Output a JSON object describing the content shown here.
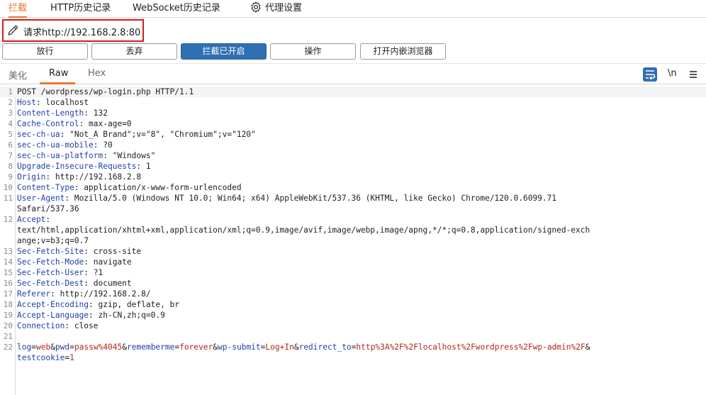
{
  "top_tabs": [
    "拦截",
    "HTTP历史记录",
    "WebSocket历史记录",
    "代理设置"
  ],
  "request_line": "请求http://192.168.2.8:80",
  "buttons": {
    "forward": "放行",
    "drop": "丢弃",
    "intercept": "拦截已开启",
    "action": "操作",
    "browser": "打开内嵌浏览器"
  },
  "editor_tabs": [
    "美化",
    "Raw",
    "Hex"
  ],
  "tools": {
    "newline": "\\n"
  },
  "colors": {
    "accent": "#e8772e",
    "primary": "#2f6fb3",
    "highlight_box": "#d91a1a",
    "header_key": "#1f3fa8",
    "param_value": "#b0281c"
  },
  "lines": [
    {
      "n": "1",
      "key": "",
      "val": "POST /wordpress/wp-login.php HTTP/1.1"
    },
    {
      "n": "2",
      "key": "Host",
      "val": ": localhost"
    },
    {
      "n": "3",
      "key": "Content-Length",
      "val": ": 132"
    },
    {
      "n": "4",
      "key": "Cache-Control",
      "val": ": max-age=0"
    },
    {
      "n": "5",
      "key": "sec-ch-ua",
      "val": ": \"Not_A Brand\";v=\"8\", \"Chromium\";v=\"120\""
    },
    {
      "n": "6",
      "key": "sec-ch-ua-mobile",
      "val": ": ?0"
    },
    {
      "n": "7",
      "key": "sec-ch-ua-platform",
      "val": ": \"Windows\""
    },
    {
      "n": "8",
      "key": "Upgrade-Insecure-Requests",
      "val": ": 1"
    },
    {
      "n": "9",
      "key": "Origin",
      "val": ": http://192.168.2.8"
    },
    {
      "n": "10",
      "key": "Content-Type",
      "val": ": application/x-www-form-urlencoded"
    },
    {
      "n": "11",
      "key": "User-Agent",
      "val": ": Mozilla/5.0 (Windows NT 10.0; Win64; x64) AppleWebKit/537.36 (KHTML, like Gecko) Chrome/120.0.6099.71"
    },
    {
      "n": "",
      "key": "",
      "val": "Safari/537.36"
    },
    {
      "n": "12",
      "key": "Accept",
      "val": ":"
    },
    {
      "n": "",
      "key": "",
      "val": "text/html,application/xhtml+xml,application/xml;q=0.9,image/avif,image/webp,image/apng,*/*;q=0.8,application/signed-exch"
    },
    {
      "n": "",
      "key": "",
      "val": "ange;v=b3;q=0.7"
    },
    {
      "n": "13",
      "key": "Sec-Fetch-Site",
      "val": ": cross-site"
    },
    {
      "n": "14",
      "key": "Sec-Fetch-Mode",
      "val": ": navigate"
    },
    {
      "n": "15",
      "key": "Sec-Fetch-User",
      "val": ": ?1"
    },
    {
      "n": "16",
      "key": "Sec-Fetch-Dest",
      "val": ": document"
    },
    {
      "n": "17",
      "key": "Referer",
      "val": ": http://192.168.2.8/"
    },
    {
      "n": "18",
      "key": "Accept-Encoding",
      "val": ": gzip, deflate, br"
    },
    {
      "n": "19",
      "key": "Accept-Language",
      "val": ": zh-CN,zh;q=0.9"
    },
    {
      "n": "20",
      "key": "Connection",
      "val": ": close"
    },
    {
      "n": "21",
      "key": "",
      "val": ""
    }
  ],
  "body_line": {
    "n": "22",
    "parts": [
      [
        "log",
        "="
      ],
      [
        "web",
        "&"
      ],
      [
        "pwd",
        "="
      ],
      [
        "passw%4045",
        "&"
      ],
      [
        "rememberme",
        "="
      ],
      [
        "forever",
        "&"
      ],
      [
        "wp-submit",
        "="
      ],
      [
        "Log+In",
        "&"
      ],
      [
        "redirect_to",
        "="
      ],
      [
        "http%3A%2F%2Flocalhost%2Fwordpress%2Fwp-admin%2F",
        "&"
      ]
    ],
    "cont": [
      [
        "testcookie",
        "="
      ],
      [
        "1",
        ""
      ]
    ]
  }
}
